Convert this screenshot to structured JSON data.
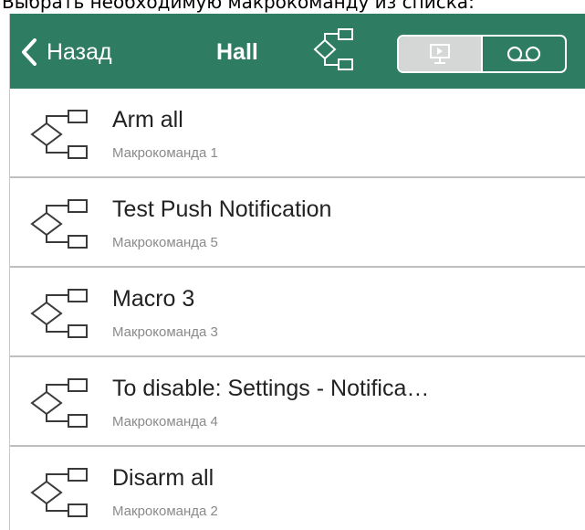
{
  "caption": "Выбрать необходимую макрокоманду из списка:",
  "navbar": {
    "back_label": "Назад",
    "title": "Hall",
    "bg_color": "#2e7c61",
    "segments": [
      {
        "icon": "monitor-icon",
        "active": true
      },
      {
        "icon": "voicemail-icon",
        "active": false
      }
    ]
  },
  "macros": [
    {
      "title": "Arm all",
      "subtitle": "Макрокоманда 1",
      "icon": "macro-icon"
    },
    {
      "title": "Test Push Notification",
      "subtitle": "Макрокоманда 5",
      "icon": "macro-icon"
    },
    {
      "title": "Macro 3",
      "subtitle": "Макрокоманда 3",
      "icon": "macro-icon"
    },
    {
      "title": "To disable: Settings - Notifica…",
      "subtitle": "Макрокоманда 4",
      "icon": "macro-icon"
    },
    {
      "title": "Disarm all",
      "subtitle": "Макрокоманда 2",
      "icon": "macro-icon"
    }
  ]
}
